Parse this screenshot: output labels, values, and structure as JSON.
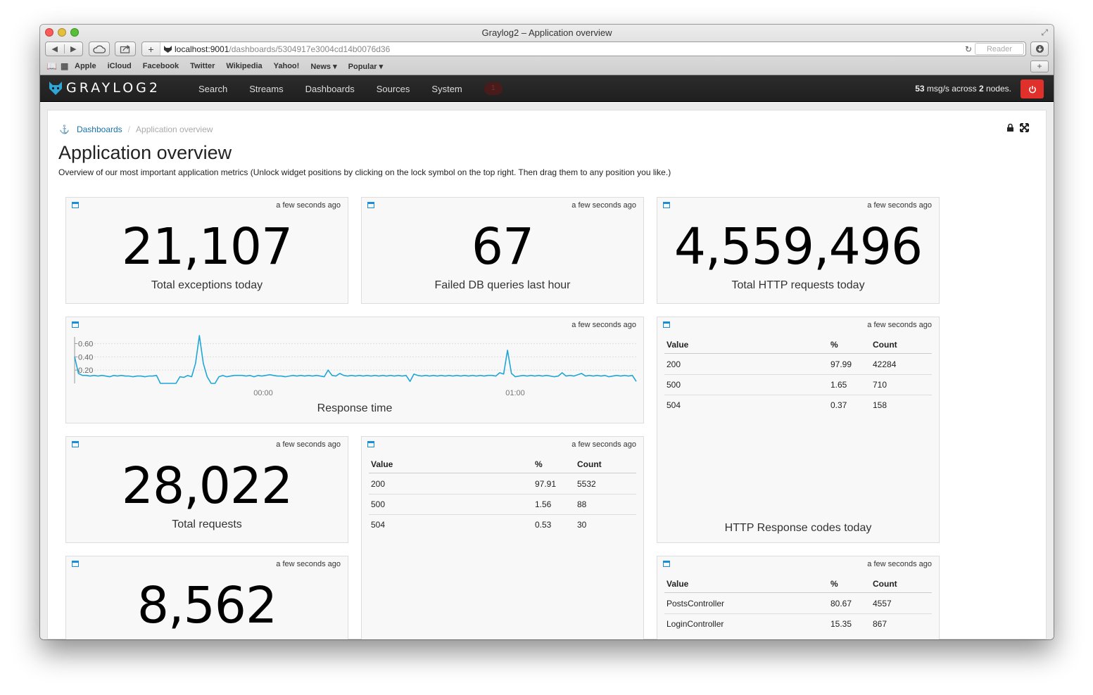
{
  "window": {
    "title": "Graylog2 – Application overview"
  },
  "browser": {
    "url_host": "localhost:9001",
    "url_path": "/dashboards/5304917e3004cd14b0076d36",
    "reader_label": "Reader",
    "bookmarks": [
      "Apple",
      "iCloud",
      "Facebook",
      "Twitter",
      "Wikipedia",
      "Yahoo!",
      "News ▾",
      "Popular ▾"
    ]
  },
  "navbar": {
    "brand": "GRAYLOG2",
    "items": [
      "Search",
      "Streams",
      "Dashboards",
      "Sources",
      "System"
    ],
    "notification_count": "1",
    "throughput_rate": "53",
    "throughput_mid": " msg/s across ",
    "throughput_nodes": "2",
    "throughput_end": " nodes."
  },
  "breadcrumb": {
    "link": "Dashboards",
    "active": "Application overview"
  },
  "page": {
    "title": "Application overview",
    "description": "Overview of our most important application metrics (Unlock widget positions by clicking on the lock symbol on the top right. Then drag them to any position you like.)"
  },
  "widgets": {
    "exceptions": {
      "time": "a few seconds ago",
      "value": "21,107",
      "label": "Total exceptions today"
    },
    "failed_db": {
      "time": "a few seconds ago",
      "value": "67",
      "label": "Failed DB queries last hour"
    },
    "http_requests": {
      "time": "a few seconds ago",
      "value": "4,559,496",
      "label": "Total HTTP requests today"
    },
    "response_time": {
      "time": "a few seconds ago",
      "label": "Response time"
    },
    "total_requests": {
      "time": "a few seconds ago",
      "value": "28,022",
      "label": "Total requests"
    },
    "widget_8562": {
      "time": "a few seconds ago",
      "value": "8,562"
    },
    "codes_today": {
      "time": "a few seconds ago",
      "label": "HTTP Response codes today",
      "headers": [
        "Value",
        "%",
        "Count"
      ],
      "rows": [
        [
          "200",
          "97.99",
          "42284"
        ],
        [
          "500",
          "1.65",
          "710"
        ],
        [
          "504",
          "0.37",
          "158"
        ]
      ]
    },
    "codes_recent": {
      "time": "a few seconds ago",
      "headers": [
        "Value",
        "%",
        "Count"
      ],
      "rows": [
        [
          "200",
          "97.91",
          "5532"
        ],
        [
          "500",
          "1.56",
          "88"
        ],
        [
          "504",
          "0.53",
          "30"
        ]
      ]
    },
    "controllers": {
      "time": "a few seconds ago",
      "headers": [
        "Value",
        "%",
        "Count"
      ],
      "rows": [
        [
          "PostsController",
          "80.67",
          "4557"
        ],
        [
          "LoginController",
          "15.35",
          "867"
        ]
      ]
    }
  },
  "chart_data": {
    "type": "line",
    "title": "Response time",
    "yticks": [
      "0.60",
      "0.40",
      "0.20"
    ],
    "ylim": [
      0,
      0.7
    ],
    "xticks": [
      "00:00",
      "01:00"
    ],
    "color": "#1fa6d9",
    "values": [
      0.4,
      0.15,
      0.12,
      0.12,
      0.11,
      0.12,
      0.11,
      0.12,
      0.11,
      0.1,
      0.12,
      0.11,
      0.12,
      0.11,
      0.11,
      0.1,
      0.11,
      0.11,
      0.1,
      0.11,
      0.11,
      0.12,
      0.0,
      0.0,
      0.0,
      0.0,
      0.0,
      0.1,
      0.09,
      0.12,
      0.1,
      0.3,
      0.72,
      0.3,
      0.1,
      0.0,
      0.0,
      0.1,
      0.12,
      0.1,
      0.11,
      0.12,
      0.12,
      0.12,
      0.11,
      0.12,
      0.1,
      0.12,
      0.11,
      0.12,
      0.13,
      0.12,
      0.11,
      0.11,
      0.1,
      0.11,
      0.12,
      0.11,
      0.12,
      0.11,
      0.12,
      0.11,
      0.12,
      0.11,
      0.1,
      0.2,
      0.12,
      0.11,
      0.15,
      0.12,
      0.11,
      0.12,
      0.11,
      0.12,
      0.11,
      0.12,
      0.11,
      0.12,
      0.11,
      0.12,
      0.11,
      0.12,
      0.11,
      0.12,
      0.11,
      0.12,
      0.03,
      0.14,
      0.12,
      0.11,
      0.12,
      0.11,
      0.12,
      0.11,
      0.12,
      0.11,
      0.12,
      0.11,
      0.12,
      0.11,
      0.12,
      0.11,
      0.12,
      0.11,
      0.12,
      0.11,
      0.12,
      0.12,
      0.11,
      0.16,
      0.14,
      0.5,
      0.15,
      0.1,
      0.11,
      0.12,
      0.11,
      0.12,
      0.11,
      0.12,
      0.11,
      0.12,
      0.11,
      0.1,
      0.11,
      0.16,
      0.11,
      0.12,
      0.11,
      0.13,
      0.15,
      0.11,
      0.12,
      0.11,
      0.12,
      0.11,
      0.12,
      0.1,
      0.11,
      0.12,
      0.11,
      0.12,
      0.11,
      0.12,
      0.03
    ]
  }
}
